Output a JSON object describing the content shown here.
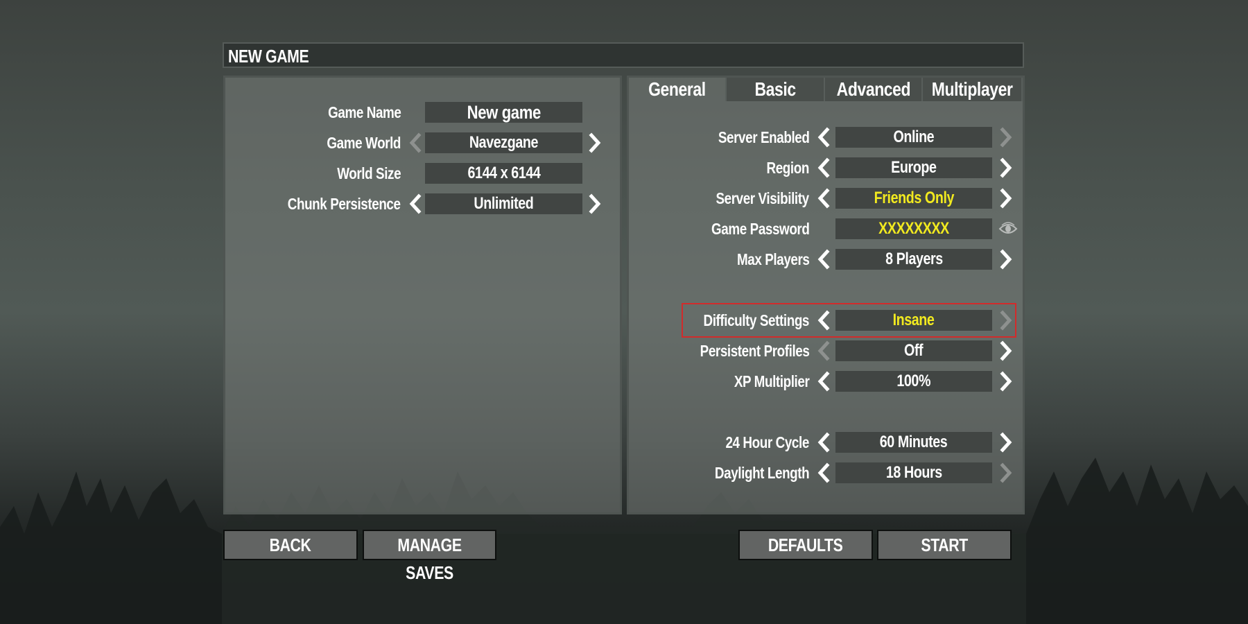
{
  "window": {
    "title": "NEW GAME"
  },
  "left_panel": {
    "rows": [
      {
        "label": "Game Name",
        "value": "New game",
        "left_arrow": "none",
        "right_arrow": "none"
      },
      {
        "label": "Game World",
        "value": "Navezgane",
        "left_arrow": "disabled",
        "right_arrow": "enabled"
      },
      {
        "label": "World Size",
        "value": "6144 x 6144",
        "left_arrow": "none",
        "right_arrow": "none"
      },
      {
        "label": "Chunk Persistence",
        "value": "Unlimited",
        "left_arrow": "enabled",
        "right_arrow": "enabled"
      }
    ]
  },
  "right_panel": {
    "tabs": [
      {
        "label": "General",
        "active": true
      },
      {
        "label": "Basic",
        "active": false
      },
      {
        "label": "Advanced",
        "active": false
      },
      {
        "label": "Multiplayer",
        "active": false
      }
    ],
    "rows": [
      {
        "label": "Server Enabled",
        "value": "Online",
        "highlight_value": false,
        "left_arrow": "enabled",
        "right_arrow": "disabled"
      },
      {
        "label": "Region",
        "value": "Europe",
        "highlight_value": false,
        "left_arrow": "enabled",
        "right_arrow": "enabled"
      },
      {
        "label": "Server Visibility",
        "value": "Friends Only",
        "highlight_value": true,
        "left_arrow": "enabled",
        "right_arrow": "enabled"
      },
      {
        "label": "Game Password",
        "value": "XXXXXXXX",
        "highlight_value": true,
        "left_arrow": "none",
        "right_arrow": "eye"
      },
      {
        "label": "Max Players",
        "value": "8 Players",
        "highlight_value": false,
        "left_arrow": "enabled",
        "right_arrow": "enabled"
      },
      {
        "label": "Difficulty Settings",
        "value": "Insane",
        "highlight_value": true,
        "left_arrow": "enabled",
        "right_arrow": "disabled",
        "outlined": true
      },
      {
        "label": "Persistent Profiles",
        "value": "Off",
        "highlight_value": false,
        "left_arrow": "disabled",
        "right_arrow": "enabled"
      },
      {
        "label": "XP Multiplier",
        "value": "100%",
        "highlight_value": false,
        "left_arrow": "enabled",
        "right_arrow": "enabled"
      },
      {
        "label": "24 Hour Cycle",
        "value": "60 Minutes",
        "highlight_value": false,
        "left_arrow": "enabled",
        "right_arrow": "enabled"
      },
      {
        "label": "Daylight Length",
        "value": "18 Hours",
        "highlight_value": false,
        "left_arrow": "enabled",
        "right_arrow": "disabled"
      }
    ]
  },
  "buttons": {
    "back": "BACK",
    "manage_saves": "MANAGE SAVES",
    "defaults": "DEFAULTS",
    "start": "START"
  },
  "colors": {
    "value_highlight": "#f2ea1f",
    "outline": "#d22b2b",
    "arrow_enabled": "#ffffff",
    "arrow_disabled": "#8e918f"
  }
}
